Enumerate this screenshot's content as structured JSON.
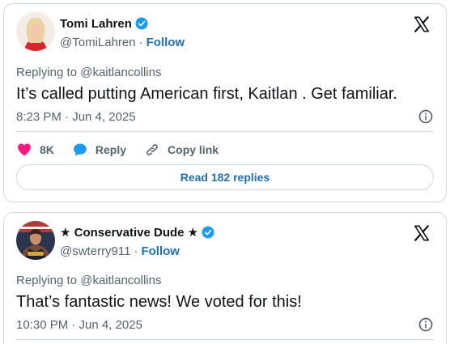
{
  "colors": {
    "link_blue": "#1d6fb8",
    "verified_blue": "#1d9bf0",
    "like_pink": "#f91880",
    "muted_gray": "#536471",
    "border": "#cfd9de"
  },
  "tweets": [
    {
      "author": {
        "display_name": "Tomi Lahren",
        "handle": "@TomiLahren",
        "follow_label": "Follow",
        "verified": true
      },
      "replying_to": "Replying to @kaitlancollins",
      "text": "It’s called putting American first, Kaitlan . Get familiar.",
      "timestamp": "8:23 PM · Jun 4, 2025",
      "actions": {
        "like_count": "8K",
        "reply_label": "Reply",
        "copy_link_label": "Copy link"
      },
      "read_replies_label": "Read 182 replies"
    },
    {
      "author": {
        "display_name": "★ Conservative Dude ★",
        "handle": "@swterry911",
        "follow_label": "Follow",
        "verified": true
      },
      "replying_to": "Replying to @kaitlancollins",
      "text": "That’s fantastic news! We voted for this!",
      "timestamp": "10:30 PM · Jun 4, 2025"
    }
  ],
  "icons": {
    "platform": "x-logo-icon",
    "verified": "verified-badge-icon",
    "info": "info-icon",
    "like": "heart-icon",
    "reply": "speech-bubble-icon",
    "copy_link": "link-icon"
  }
}
